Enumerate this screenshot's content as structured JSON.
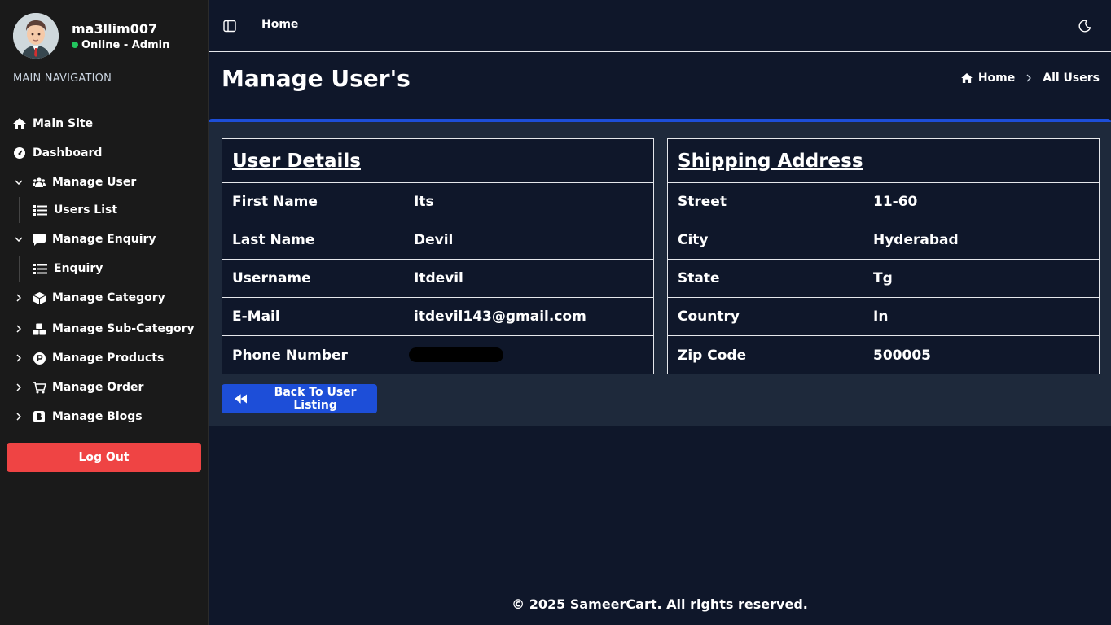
{
  "colors": {
    "sidebar_bg": "#1a1a1a",
    "main_bg": "#0f172a",
    "card_bg": "#1e293b",
    "accent": "#1d4ed8",
    "logout": "#ef4444",
    "online": "#22c55e"
  },
  "profile": {
    "username": "ma3llim007",
    "status": "Online - Admin"
  },
  "sidebar": {
    "heading": "MAIN NAVIGATION",
    "items": [
      {
        "label": "Main Site",
        "icon": "home-icon"
      },
      {
        "label": "Dashboard",
        "icon": "gauge-icon"
      },
      {
        "label": "Manage User",
        "icon": "users-icon",
        "expanded": true,
        "sub": "Users List"
      },
      {
        "label": "Manage Enquiry",
        "icon": "chat-icon",
        "expanded": true,
        "sub": "Enquiry"
      },
      {
        "label": "Manage Category",
        "icon": "box-icon"
      },
      {
        "label": "Manage Sub-Category",
        "icon": "boxes-icon"
      },
      {
        "label": "Manage Products",
        "icon": "product-icon"
      },
      {
        "label": "Manage Order",
        "icon": "cart-icon"
      },
      {
        "label": "Manage Blogs",
        "icon": "blog-icon"
      }
    ],
    "logout_label": "Log Out"
  },
  "topbar": {
    "home_label": "Home"
  },
  "page": {
    "title": "Manage User's",
    "breadcrumb_home": "Home",
    "breadcrumb_current": "All Users"
  },
  "user_details": {
    "heading": "User Details",
    "rows": [
      {
        "label": "First Name",
        "value": "Its"
      },
      {
        "label": "Last Name",
        "value": "Devil"
      },
      {
        "label": "Username",
        "value": "Itdevil"
      },
      {
        "label": "E-Mail",
        "value": "itdevil143@gmail.com"
      },
      {
        "label": "Phone Number",
        "value": ""
      }
    ]
  },
  "shipping": {
    "heading": "Shipping Address",
    "rows": [
      {
        "label": "Street",
        "value": "11-60"
      },
      {
        "label": "City",
        "value": "Hyderabad"
      },
      {
        "label": "State",
        "value": "Tg"
      },
      {
        "label": "Country",
        "value": "In"
      },
      {
        "label": "Zip Code",
        "value": "500005"
      }
    ]
  },
  "back_button": "Back To User Listing",
  "footer": "© 2025 SameerCart. All rights reserved."
}
